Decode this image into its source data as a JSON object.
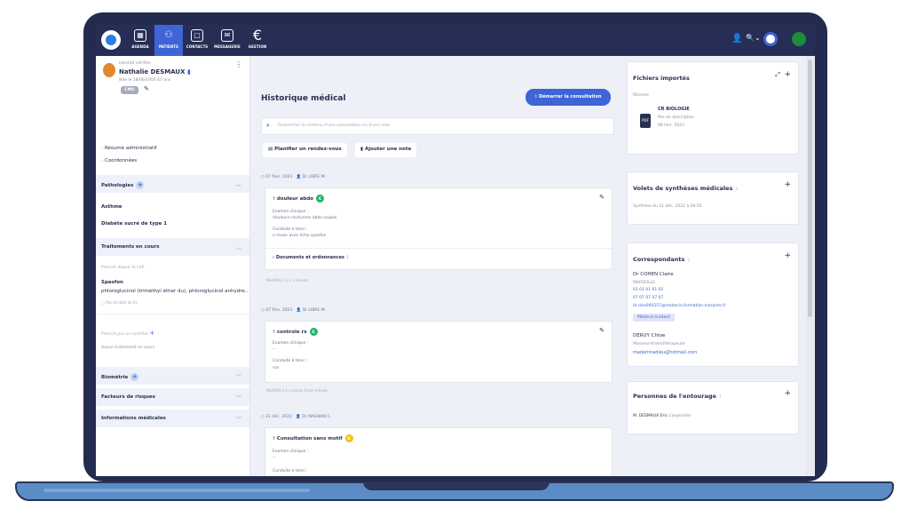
{
  "nav": {
    "items": [
      {
        "label": "AGENDA",
        "icon": "calendar-icon"
      },
      {
        "label": "PATIENTS",
        "icon": "patients-icon",
        "active": true
      },
      {
        "label": "CONTACTS",
        "icon": "contacts-icon"
      },
      {
        "label": "MESSAGERIE",
        "icon": "mail-icon"
      },
      {
        "label": "GESTION",
        "icon": "euro-icon"
      }
    ],
    "colors": {
      "bar": "#262e55",
      "active": "#3f64d6"
    }
  },
  "patient": {
    "identity_label": "Identité vérifiée",
    "name": "Nathalie DESMAUX",
    "birth": "Née le 18/06/1956 67 ans",
    "badge": "CMU"
  },
  "left": {
    "links": [
      "Résumé administratif",
      "Coordonnées"
    ],
    "pathologies": {
      "title": "Pathologies",
      "items": [
        "Asthme",
        "Diabète sucré de type 1"
      ]
    },
    "treatments": {
      "title": "Traitements en cours",
      "lap_label": "Prescrit depuis le LAP",
      "drug_name": "Spasfon",
      "drug_detail": "phloroglucinol (triméthyl éther du), phloroglucinol anhydre...",
      "drug_note": "Pas de date de fin",
      "external_label": "Prescrit par un confrère",
      "none_text": "Aucun traitement en cours"
    },
    "biometrie": "Biométrie",
    "risques": "Facteurs de risques",
    "infos": "Informations médicales"
  },
  "history": {
    "title": "Historique médical",
    "start_button": "Démarrer la consultation",
    "search_placeholder": "Rechercher le contenu d'une consultation ou d'une note",
    "plan_button": "Planifier un rendez-vous",
    "note_button": "Ajouter une note",
    "entries": [
      {
        "date": "07 févr. 2023",
        "doctor": "Dr LIBRE M.",
        "title": "douleur abdo",
        "exam_label": "Examen clinique :",
        "exam_value": "douleurs nocturnes abdo souple",
        "plan_label": "Conduite à tenir :",
        "plan_value": "a revoir avec écho spasfon",
        "docs": "Documents et ordonnances",
        "docs_count": "1",
        "modified": "Modifiée il y a 1 minute"
      },
      {
        "date": "07 févr. 2023",
        "doctor": "Dr LIBRE M.",
        "title": "controle rx",
        "exam_label": "Examen clinique :",
        "exam_value": "--",
        "plan_label": "Conduite à tenir :",
        "plan_value": "rsa",
        "modified": "Modifiée il y a moins d'une minute"
      },
      {
        "date": "21 déc. 2022",
        "doctor": "Dr MAGNAN C.",
        "title": "Consultation sans motif",
        "exam_label": "Examen clinique :",
        "exam_value": "--",
        "plan_label": "Conduite à tenir :",
        "plan_value": "--"
      }
    ]
  },
  "right": {
    "files": {
      "title": "Fichiers importés",
      "recent_label": "Récents",
      "file_name": "CR BIOLOGIE",
      "file_desc": "Pas de description",
      "file_date": "08 févr. 2023"
    },
    "synth": {
      "title": "Volets de synthèses médicales",
      "count": "1",
      "item": "Synthèse du 21 déc. 2022 à 09:56"
    },
    "corr": {
      "title": "Correspondants",
      "count": "2",
      "c1_name": "Dr COHEN Claire",
      "c1_city": "MARSEILLE",
      "c1_phone1": "01 01 01 01 01",
      "c1_phone2": "07 07 07 07 07",
      "c1_mail": "id.cloo000257@medecin.formation.mssante.fr",
      "c1_badge": "Médecin traitant",
      "c2_name": "DERUY Chloe",
      "c2_role": "Masseur-Kinésithérapeute",
      "c2_mail": "madamnadieu@hotmail.com"
    },
    "entourage": {
      "title": "Personnes de l'entourage",
      "count": "1",
      "person": "M. DESMAUX Eric",
      "relation": "Conjoint(e)"
    }
  }
}
